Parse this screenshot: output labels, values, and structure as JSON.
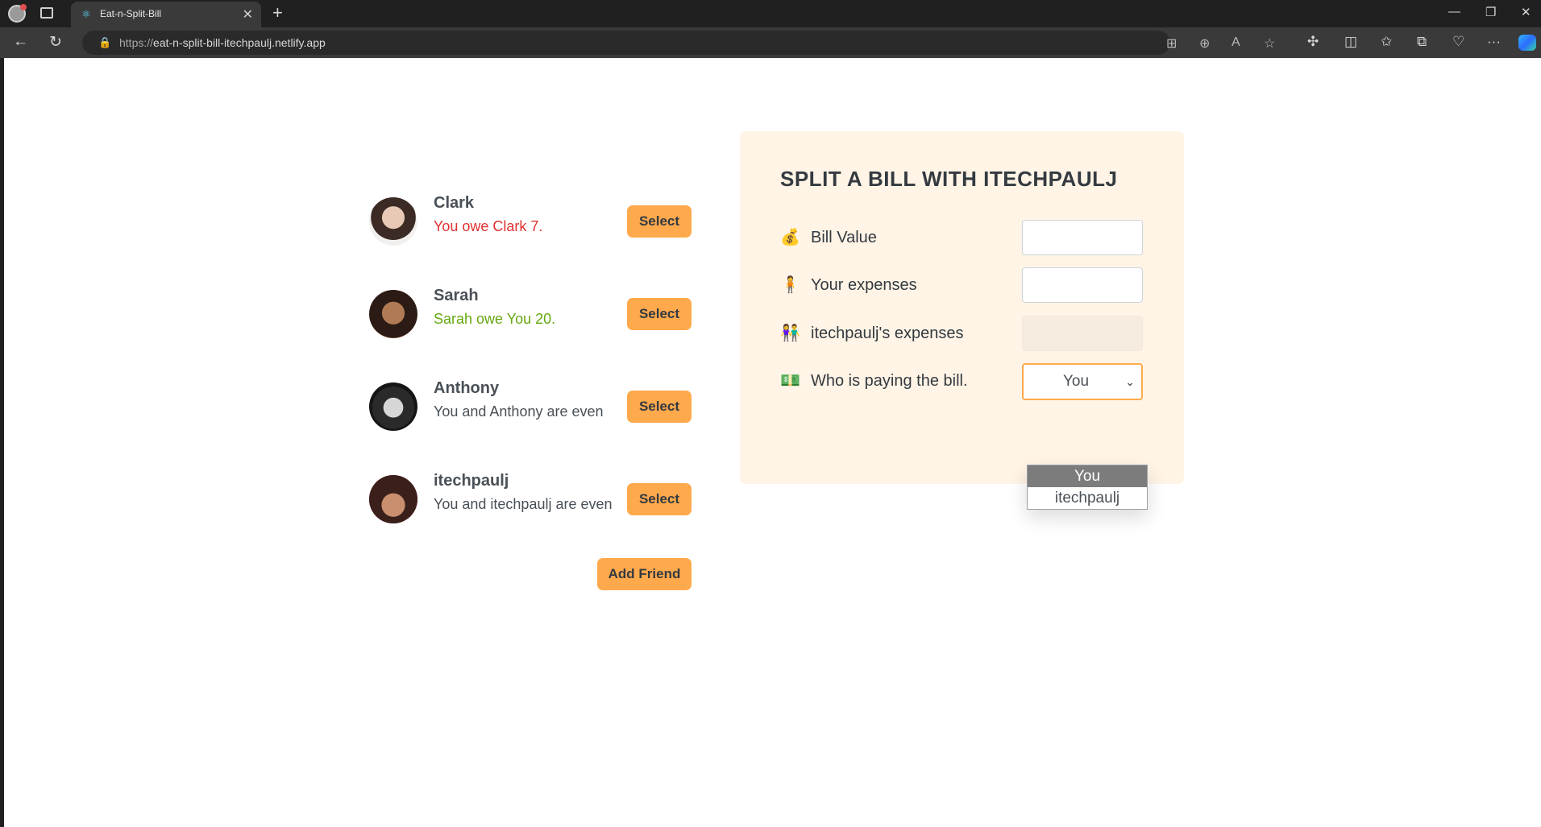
{
  "browser": {
    "tab_title": "Eat-n-Split-Bill",
    "url_protocol": "https://",
    "url_host": "eat-n-split-bill-itechpaulj.netlify.app"
  },
  "friends": [
    {
      "name": "Clark",
      "balance": "You owe Clark 7.",
      "status": "owe",
      "select_label": "Select"
    },
    {
      "name": "Sarah",
      "balance": "Sarah owe You 20.",
      "status": "owed",
      "select_label": "Select"
    },
    {
      "name": "Anthony",
      "balance": "You and Anthony are even",
      "status": "even",
      "select_label": "Select"
    },
    {
      "name": "itechpaulj",
      "balance": "You and itechpaulj are even",
      "status": "even",
      "select_label": "Select"
    }
  ],
  "add_friend_label": "Add Friend",
  "split_form": {
    "title": "SPLIT A BILL WITH ITECHPAULJ",
    "bill_value": {
      "icon": "💰",
      "label": "Bill Value",
      "value": ""
    },
    "your_expense": {
      "icon": "🧍",
      "label": "Your expenses",
      "value": ""
    },
    "friend_expense": {
      "icon": "👫",
      "label": "itechpaulj's expenses",
      "value": ""
    },
    "payer": {
      "icon": "💵",
      "label": "Who is paying the bill.",
      "selected": "You",
      "options": [
        "You",
        "itechpaulj"
      ],
      "highlighted_option": "You"
    }
  },
  "colors": {
    "accent": "#ffa94d",
    "form_background": "#fff4e6",
    "owe_text": "#e03131",
    "owed_text": "#66a80f"
  }
}
